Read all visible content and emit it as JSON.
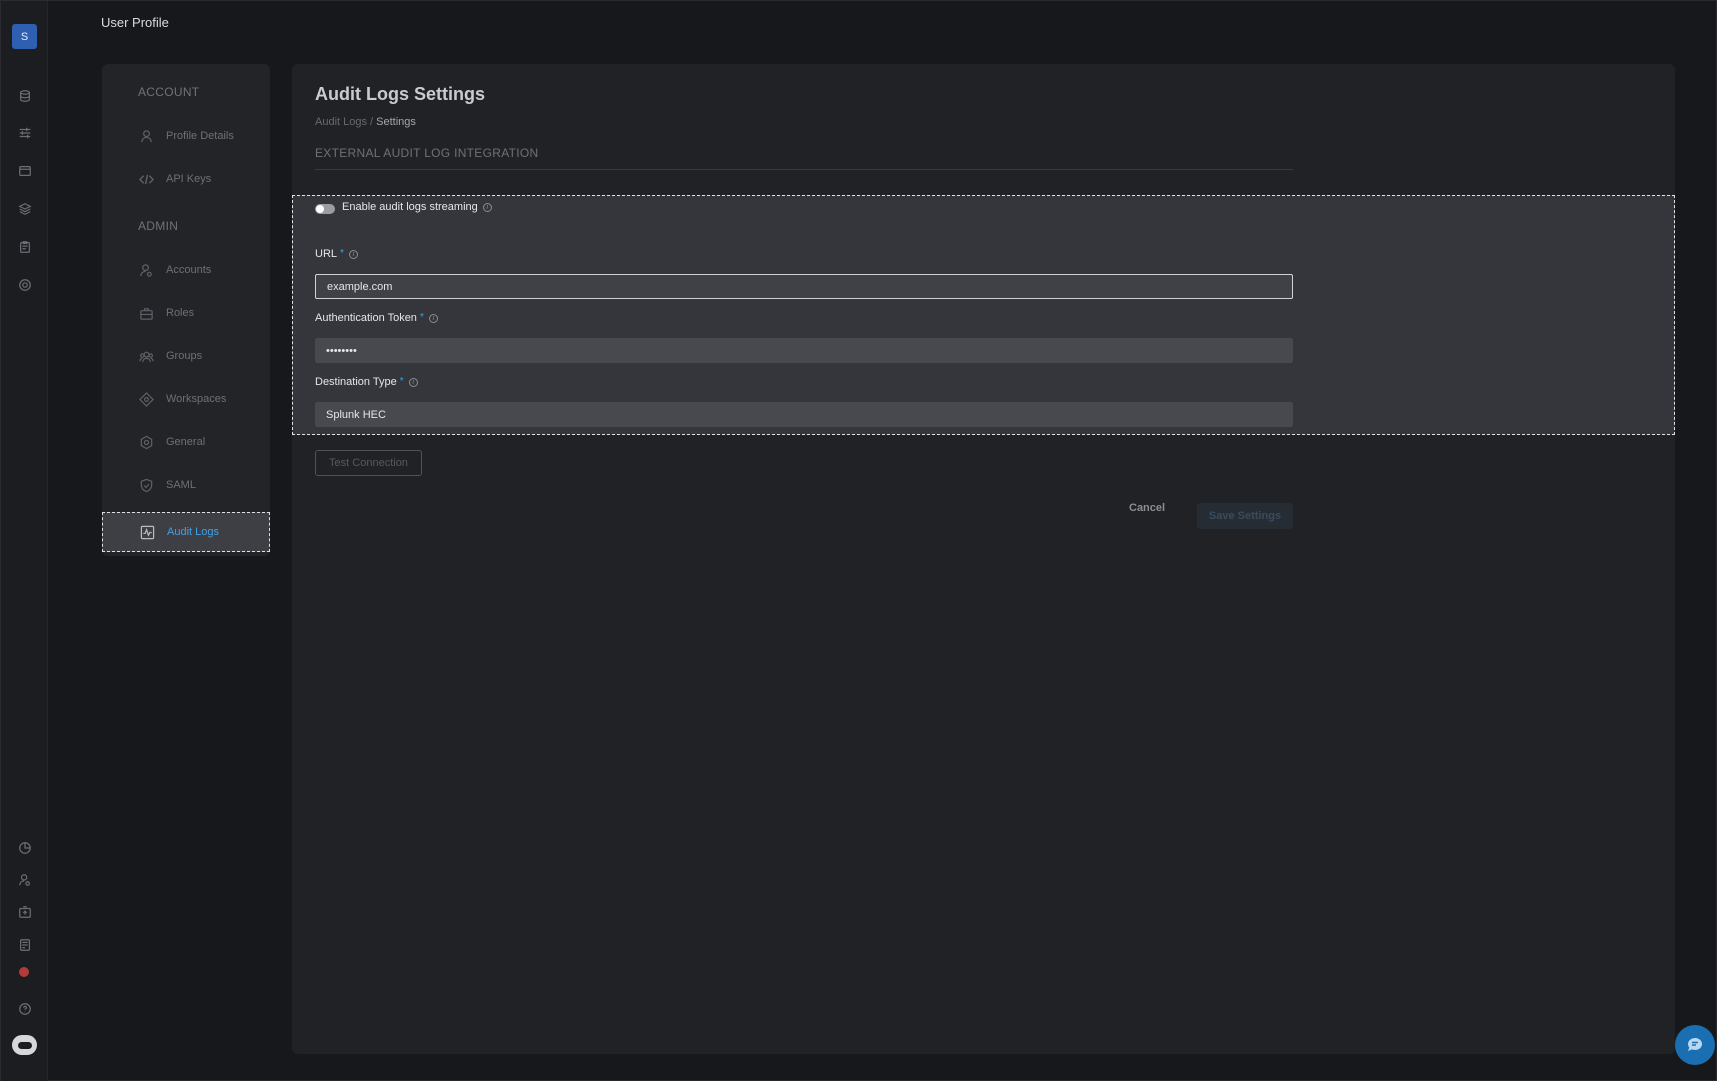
{
  "app": {
    "avatar_initial": "S",
    "header_title": "User Profile"
  },
  "rail": {
    "top_icons": [
      "database-icon",
      "sliders-icon",
      "window-icon",
      "layers-icon",
      "clipboard-icon",
      "target-icon"
    ],
    "bottom_icons": [
      "pie-chart-icon",
      "user-settings-icon",
      "upload-box-icon",
      "server-icon",
      "notification-icon",
      "help-icon",
      "bot-icon"
    ]
  },
  "nav": {
    "sections": [
      {
        "label": "ACCOUNT",
        "items": [
          {
            "label": "Profile Details",
            "icon": "user-icon"
          },
          {
            "label": "API Keys",
            "icon": "code-icon"
          }
        ]
      },
      {
        "label": "ADMIN",
        "items": [
          {
            "label": "Accounts",
            "icon": "users-icon"
          },
          {
            "label": "Roles",
            "icon": "briefcase-icon"
          },
          {
            "label": "Groups",
            "icon": "group-icon"
          },
          {
            "label": "Workspaces",
            "icon": "diamond-icon"
          },
          {
            "label": "General",
            "icon": "settings-icon"
          },
          {
            "label": "SAML",
            "icon": "shield-icon"
          },
          {
            "label": "Audit Logs",
            "icon": "activity-icon",
            "active": true
          }
        ]
      }
    ],
    "active_color": "#3fa3e8"
  },
  "main": {
    "title": "Audit Logs Settings",
    "breadcrumb": {
      "parent": "Audit Logs",
      "separator": "/",
      "current": "Settings"
    },
    "section_title": "EXTERNAL AUDIT LOG INTEGRATION",
    "toggle": {
      "label": "Enable audit logs streaming",
      "on": false
    },
    "fields": {
      "url": {
        "label": "URL",
        "required_mark": "*",
        "value": "example.com"
      },
      "token": {
        "label": "Authentication Token",
        "required_mark": "*",
        "value": "••••••••"
      },
      "destination": {
        "label": "Destination Type",
        "required_mark": "*",
        "value": "Splunk HEC"
      }
    },
    "buttons": {
      "test": "Test Connection",
      "cancel": "Cancel",
      "save": "Save Settings"
    }
  },
  "chat": {
    "icon": "chat-icon"
  }
}
